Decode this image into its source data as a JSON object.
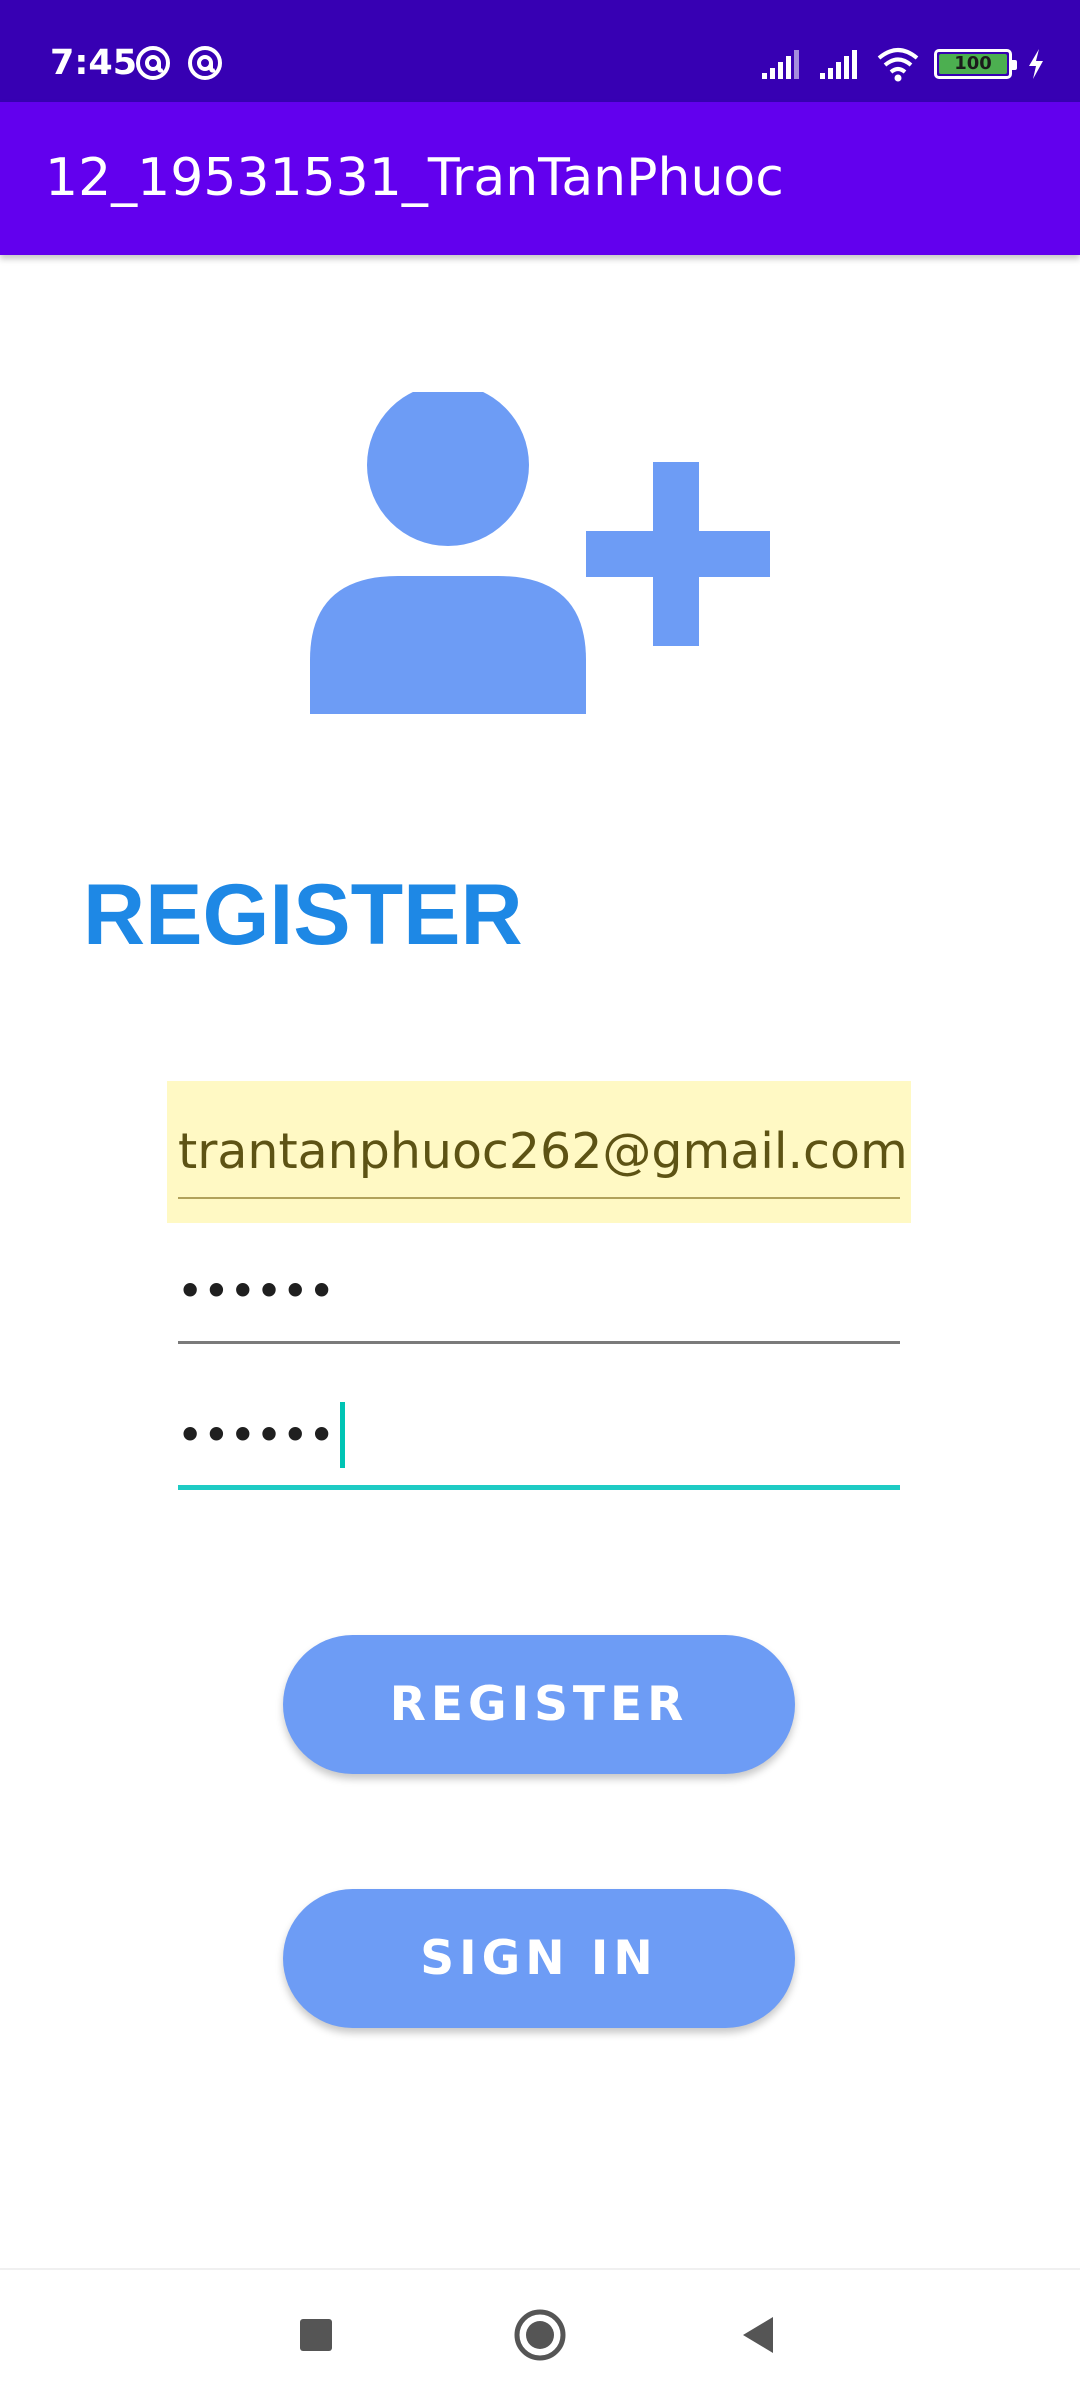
{
  "status_bar": {
    "time": "7:45",
    "battery_level": "100",
    "icons": [
      "at-sign-icon",
      "at-sign-icon",
      "signal-icon",
      "signal-icon",
      "wifi-icon",
      "battery-icon",
      "charging-bolt-icon"
    ]
  },
  "app_bar": {
    "title": "12_19531531_TranTanPhuoc"
  },
  "hero": {
    "icon": "person-add-icon",
    "color": "#6d9cf5"
  },
  "form": {
    "heading": "REGISTER",
    "email_value": "trantanphuoc262@gmail.com",
    "password_masked": "••••••",
    "confirm_password_masked": "••••••"
  },
  "buttons": {
    "register_label": "REGISTER",
    "signin_label": "SIGN IN"
  },
  "colors": {
    "status_bar": "#3700b3",
    "app_bar": "#6200ee",
    "heading": "#1e88e5",
    "button": "#6d9cf5",
    "autofill_highlight": "#fff9c4",
    "focus_underline": "#1ecbc4"
  },
  "nav_bar": {
    "icons": [
      "recents-icon",
      "home-icon",
      "back-icon"
    ]
  }
}
